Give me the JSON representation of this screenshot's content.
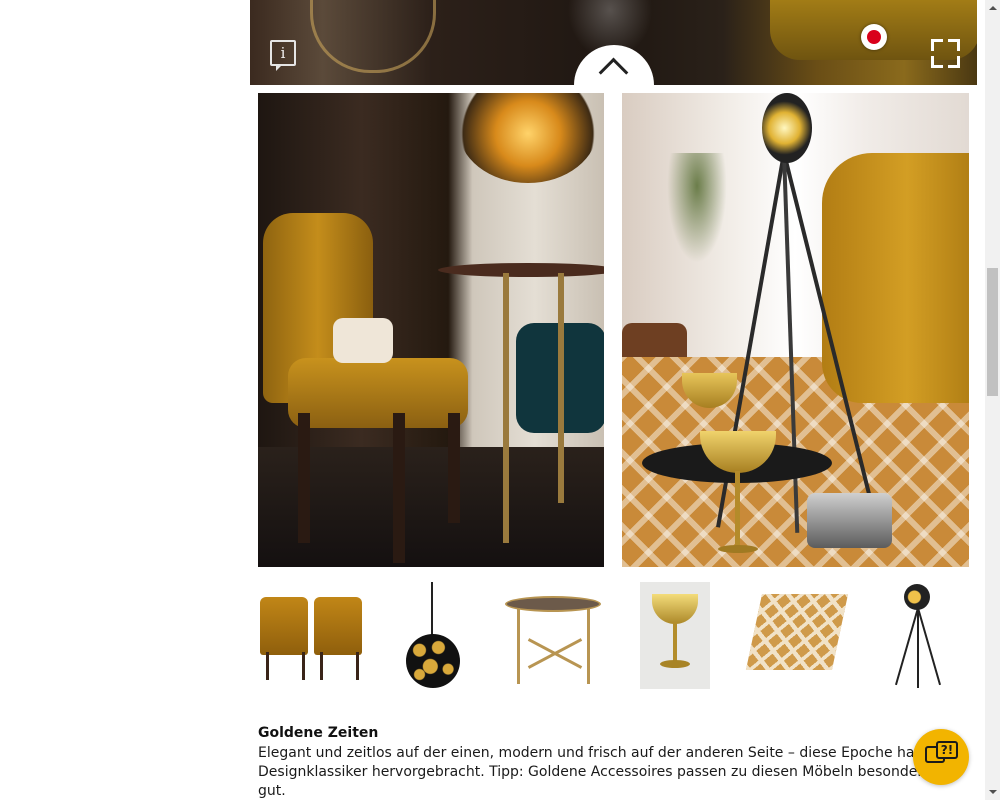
{
  "hero": {
    "info_icon": "info-icon",
    "info_glyph": "i",
    "record_icon": "record-dot-icon",
    "fullscreen_icon": "fullscreen-icon",
    "collapse_icon": "chevron-up-icon"
  },
  "gallery": {
    "left_image": "dining-chair-scene",
    "right_image": "living-room-scene"
  },
  "products": [
    {
      "name": "mustard-dining-chairs"
    },
    {
      "name": "gold-black-pendant-lamp"
    },
    {
      "name": "round-side-table"
    },
    {
      "name": "gold-champagne-glass"
    },
    {
      "name": "patterned-rug"
    },
    {
      "name": "tripod-floor-lamp"
    }
  ],
  "article": {
    "title": "Goldene Zeiten",
    "body": "Elegant und zeitlos auf der einen, modern und frisch auf der anderen Seite – diese Epoche hat viele Designklassiker hervorgebracht. Tipp: Goldene Accessoires passen zu diesen Möbeln besonders gut."
  },
  "chat": {
    "icon": "chat-bubbles-icon",
    "glyph": "?!"
  },
  "colors": {
    "accent": "#f2b400",
    "record": "#d9001b",
    "text": "#1a1a1a"
  }
}
